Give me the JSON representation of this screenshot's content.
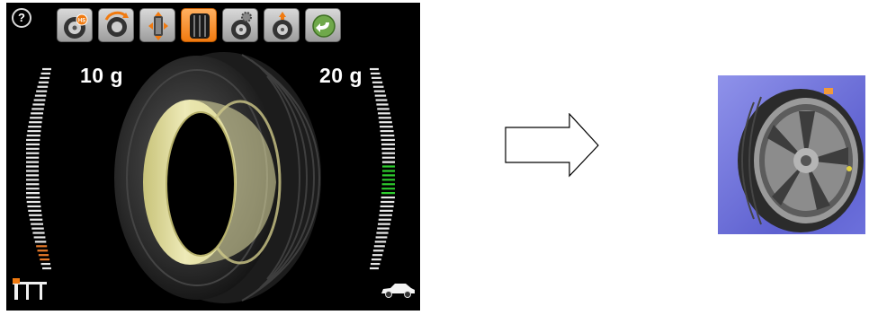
{
  "toolbar": {
    "help_glyph": "?",
    "buttons": [
      {
        "name": "wheel-hs-mode",
        "icon": "wheel-with-badge-icon",
        "badge": "HS",
        "active": false
      },
      {
        "name": "rotate-wheel",
        "icon": "rotate-wheel-icon",
        "active": false
      },
      {
        "name": "split-weights",
        "icon": "split-weights-icon",
        "active": false
      },
      {
        "name": "tire-tread",
        "icon": "tire-tread-icon",
        "active": true
      },
      {
        "name": "wheel-settings",
        "icon": "wheel-gear-icon",
        "active": false
      },
      {
        "name": "wheel-position",
        "icon": "wheel-position-icon",
        "active": false
      },
      {
        "name": "back",
        "icon": "back-arrow-icon",
        "active": false
      }
    ]
  },
  "balance": {
    "left_weight": "10 g",
    "right_weight": "20 g",
    "left_scale_level": 0.13,
    "right_scale_level": 0.54
  },
  "colors": {
    "panel_bg": "#000000",
    "active_button": "#f07a10",
    "scale_white": "#e8e8e8",
    "scale_orange": "#e87a2a",
    "scale_green": "#2ecc2e",
    "rim_highlight": "#e8e4a8"
  },
  "icons": {
    "bottom_left": "weight-clips-icon",
    "bottom_right": "car-icon",
    "arrow": "right-arrow-icon",
    "thumbnail": "wheel-3d-thumbnail"
  }
}
